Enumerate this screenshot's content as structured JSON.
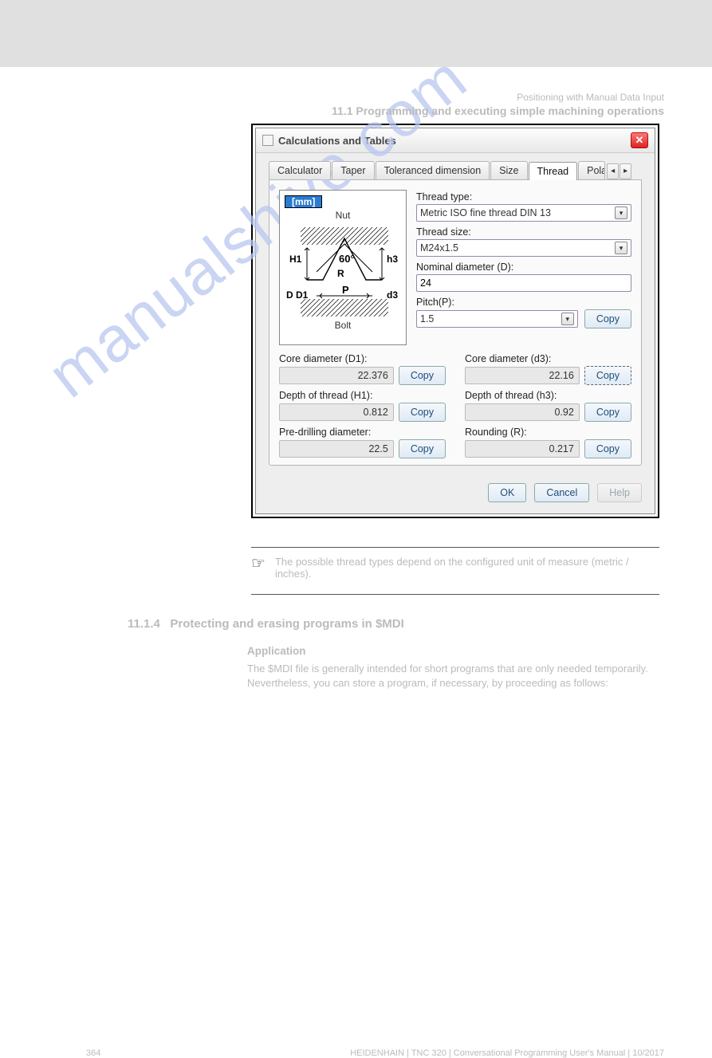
{
  "header": {
    "line1": "Positioning with Manual Data Input",
    "line2": "11.1 Programming and executing simple machining operations"
  },
  "dialog": {
    "title": "Calculations and Tables",
    "tabs": [
      "Calculator",
      "Taper",
      "Toleranced dimension",
      "Size",
      "Thread",
      "Polai"
    ],
    "active_tab": "Thread",
    "thread_type_label": "Thread type:",
    "thread_type_value": "Metric ISO fine thread DIN 13",
    "thread_size_label": "Thread size:",
    "thread_size_value": "M24x1.5",
    "nominal_label": "Nominal diameter (D):",
    "nominal_value": "24",
    "pitch_label": "Pitch(P):",
    "pitch_value": "1.5",
    "copy_label": "Copy",
    "diagram": {
      "unit_badge": "[mm]",
      "top_label": "Nut",
      "bottom_label": "Bolt",
      "angle": "60°",
      "H1": "H1",
      "D": "D",
      "D1": "D1",
      "P": "P",
      "h3": "h3",
      "d3": "d3",
      "R": "R"
    },
    "fields": {
      "d1": {
        "label": "Core diameter (D1):",
        "value": "22.376"
      },
      "d3": {
        "label": "Core diameter (d3):",
        "value": "22.16"
      },
      "h1": {
        "label": "Depth of thread (H1):",
        "value": "0.812"
      },
      "h3": {
        "label": "Depth of thread (h3):",
        "value": "0.92"
      },
      "predrill": {
        "label": "Pre-drilling diameter:",
        "value": "22.5"
      },
      "rounding": {
        "label": "Rounding (R):",
        "value": "0.217"
      }
    },
    "buttons": {
      "ok": "OK",
      "cancel": "Cancel",
      "help": "Help"
    }
  },
  "note": "The possible thread types depend on the configured unit of measure (metric / inches).",
  "section": {
    "num": "11.1.4",
    "title": "Protecting and erasing programs in $MDI",
    "subtitle": "Application",
    "para": "The $MDI file is generally intended for short programs that are only needed temporarily. Nevertheless, you can store a program, if necessary, by proceeding as follows:"
  },
  "footer": {
    "left": "364",
    "right": "HEIDENHAIN | TNC 320 | Conversational Programming User's Manual | 10/2017"
  },
  "watermark": "manualshive.com"
}
